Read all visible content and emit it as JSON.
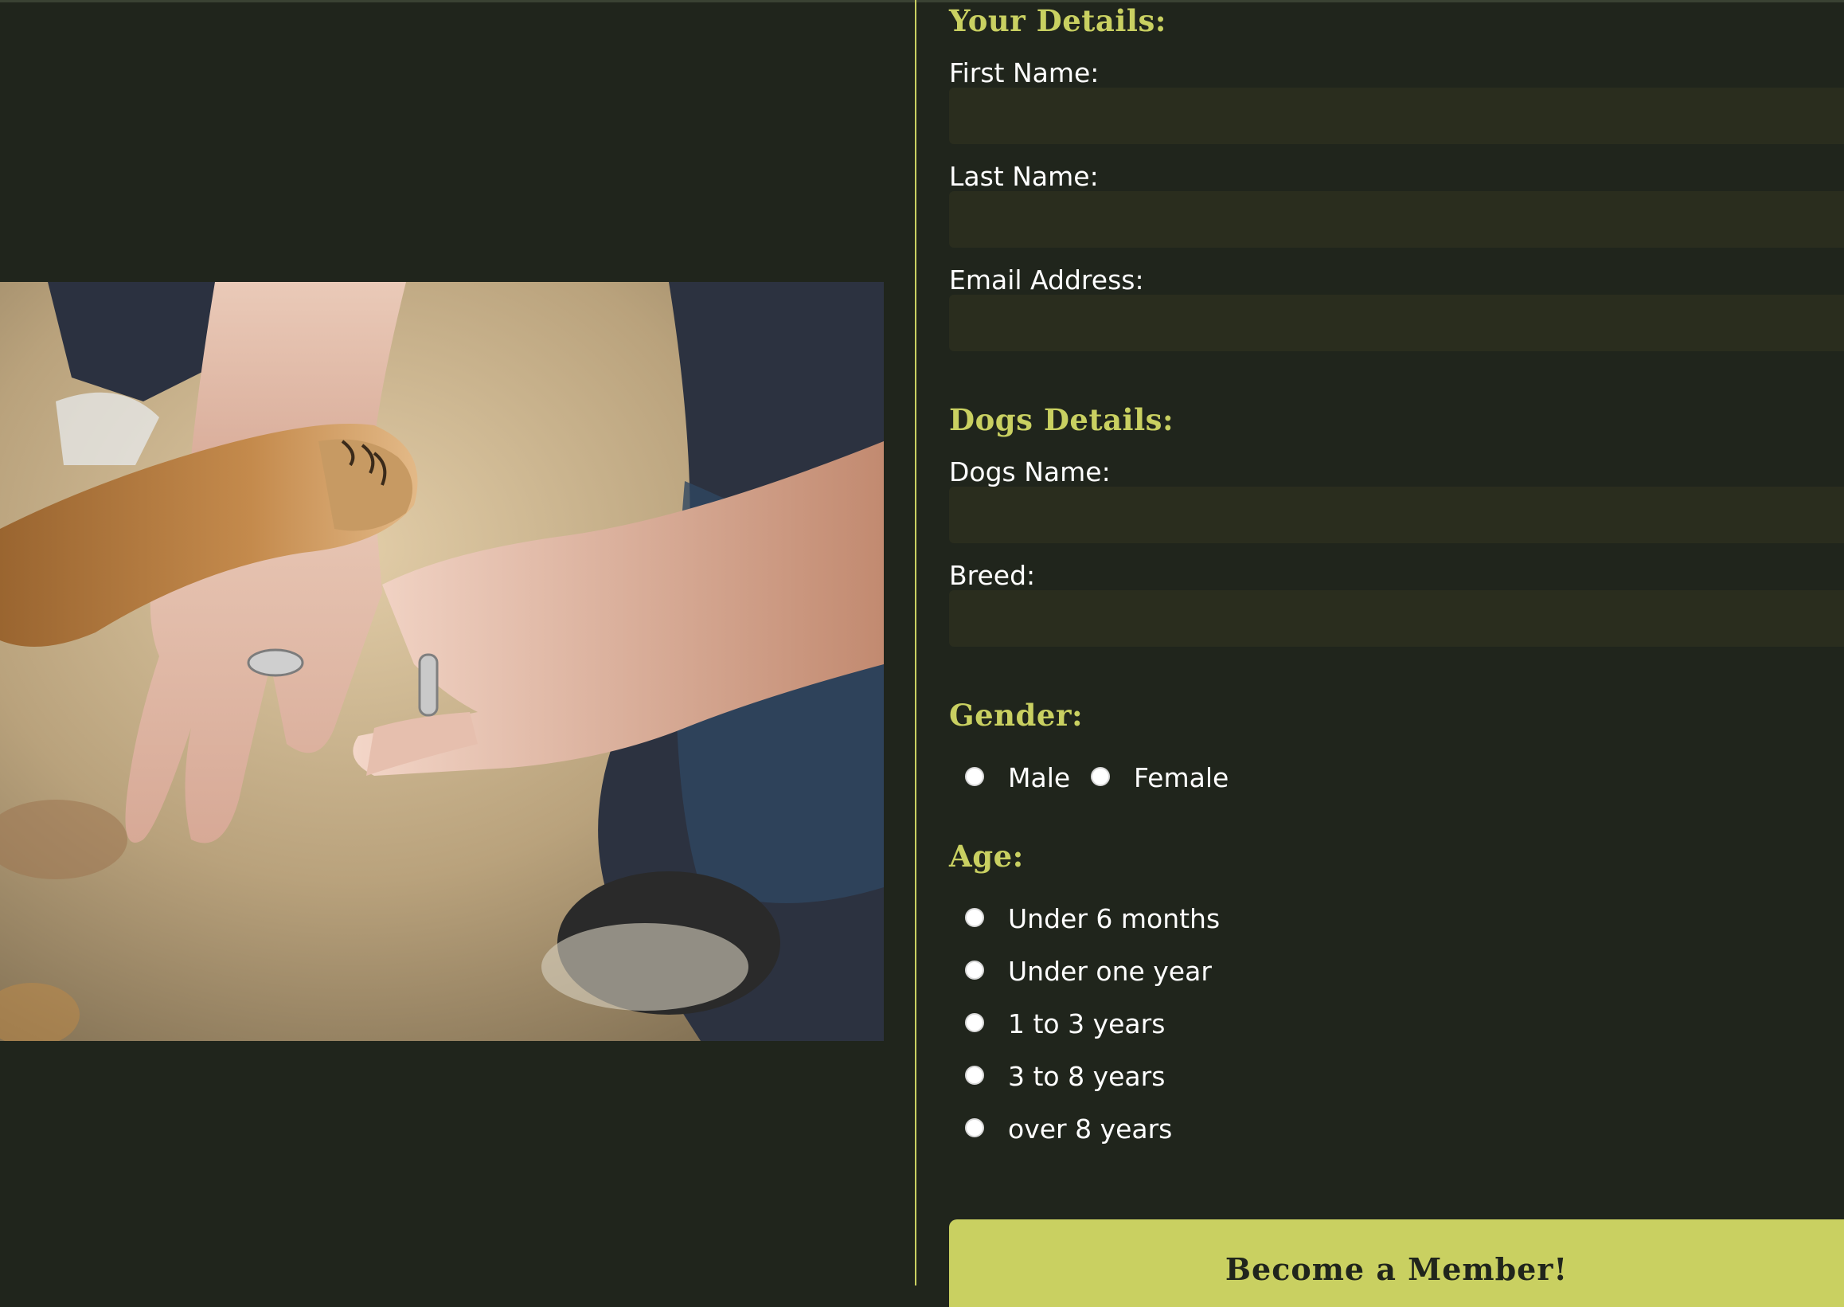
{
  "your_details": {
    "heading": "Your Details:",
    "first_name_label": "First Name:",
    "last_name_label": "Last Name:",
    "email_label": "Email Address:"
  },
  "dogs_details": {
    "heading": "Dogs Details:",
    "dogs_name_label": "Dogs Name:",
    "breed_label": "Breed:"
  },
  "gender": {
    "heading": "Gender:",
    "options": [
      "Male",
      "Female"
    ]
  },
  "age": {
    "heading": "Age:",
    "options": [
      "Under 6 months",
      "Under one year",
      "1 to 3 years",
      "3 to 8 years",
      "over 8 years"
    ]
  },
  "submit_label": "Become a Member!",
  "colors": {
    "background": "#20251c",
    "accent": "#c9d061",
    "input_bg": "#2a2d1e"
  }
}
